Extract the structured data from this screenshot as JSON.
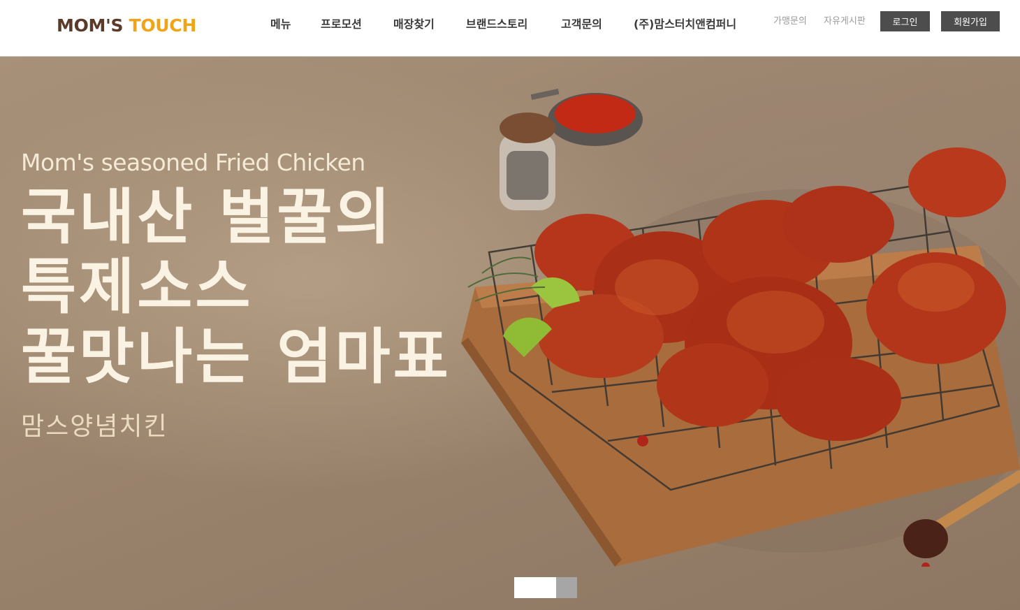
{
  "header": {
    "logo": {
      "part1": "MOM'S",
      "part2": "TOUCH"
    },
    "nav": [
      "메뉴",
      "프로모션",
      "매장찾기",
      "브랜드스토리",
      "고객문의",
      "(주)맘스터치앤컴퍼니"
    ],
    "util_links": [
      "가맹문의",
      "자유게시판"
    ],
    "login_label": "로그인",
    "signup_label": "회원가입"
  },
  "hero": {
    "eyebrow": "Mom's seasoned Fried Chicken",
    "headline": [
      "국내산 벌꿀의",
      "특제소스",
      "꿀맛나는 엄마표"
    ],
    "subtitle": "맘스양념치킨",
    "slides": {
      "total": 2,
      "active": 1
    }
  },
  "colors": {
    "brand_brown": "#5a3b2a",
    "brand_orange": "#f0a417",
    "button_dark": "#4d4d4d",
    "hero_text": "#faf3e4"
  }
}
